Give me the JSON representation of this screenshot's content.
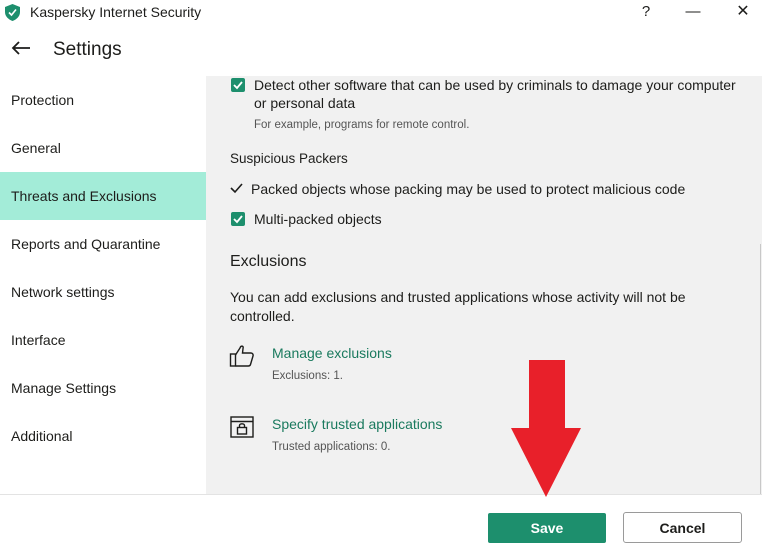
{
  "window": {
    "title": "Kaspersky Internet Security",
    "help_glyph": "?",
    "minimize_glyph": "—",
    "close_glyph": "✕"
  },
  "header": {
    "title": "Settings",
    "back_icon": "arrow-left-icon"
  },
  "sidebar": {
    "items": [
      {
        "label": "Protection",
        "active": false
      },
      {
        "label": "General",
        "active": false
      },
      {
        "label": "Threats and Exclusions",
        "active": true
      },
      {
        "label": "Reports and Quarantine",
        "active": false
      },
      {
        "label": "Network settings",
        "active": false
      },
      {
        "label": "Interface",
        "active": false
      },
      {
        "label": "Manage Settings",
        "active": false
      },
      {
        "label": "Additional",
        "active": false
      }
    ]
  },
  "main": {
    "detect_other": {
      "checked": true,
      "line1": "Detect other software that can be used by criminals to damage your computer",
      "line2": "or personal data",
      "hint": "For example, programs for remote control."
    },
    "suspicious_packers": {
      "title": "Suspicious Packers",
      "packed_objects": {
        "label": "Packed objects whose packing may be used to protect malicious code",
        "state": "always-on"
      },
      "multi_packed": {
        "label": "Multi-packed objects",
        "checked": true
      }
    },
    "exclusions": {
      "title": "Exclusions",
      "desc_line1": "You can add exclusions and trusted applications whose activity will not be",
      "desc_line2": "controlled.",
      "manage": {
        "icon": "thumbs-up-icon",
        "label": "Manage exclusions",
        "detail": "Exclusions: 1."
      },
      "trusted": {
        "icon": "locked-window-icon",
        "label": "Specify trusted applications",
        "detail": "Trusted applications: 0."
      }
    }
  },
  "footer": {
    "save_label": "Save",
    "cancel_label": "Cancel"
  },
  "colors": {
    "accent": "#1d8f6d",
    "link": "#1a7a5e",
    "sidebar_active": "#a3ecd8",
    "panel_bg": "#f1f1f1",
    "annotation_arrow": "#e8202a"
  }
}
